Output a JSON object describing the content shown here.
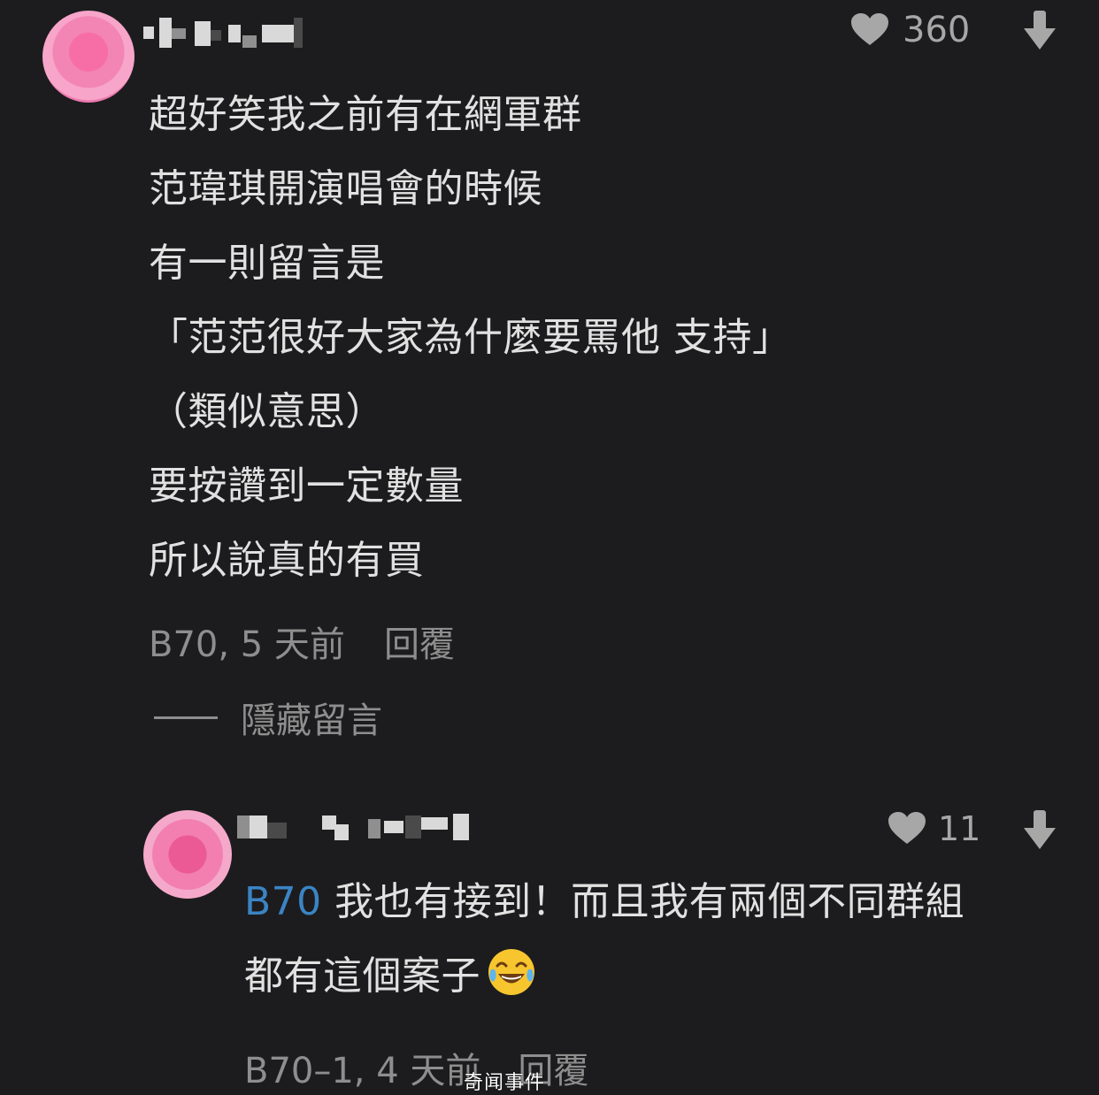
{
  "comment": {
    "likes": "360",
    "lines": [
      "超好笑我之前有在網軍群",
      "范瑋琪開演唱會的時候",
      "有一則留言是",
      "「范范很好大家為什麼要罵他 支持」",
      "（類似意思）",
      "要按讚到一定數量",
      "所以說真的有買"
    ],
    "meta": "B70, 5 天前",
    "reply_label": "回覆",
    "hide_label": "隱藏留言"
  },
  "reply": {
    "likes": "11",
    "mention": "B70",
    "line1": " 我也有接到！而且我有兩個不同群組",
    "line2": "都有這個案子",
    "meta": "B70–1, 4 天前",
    "reply_label": "回覆"
  },
  "watermark": "奇闻事件",
  "colors": {
    "background": "#1c1c1e",
    "text": "#e1e1e1",
    "muted": "#8e8e8e",
    "mention": "#3b84c4",
    "avatar": "#e87aae"
  },
  "icons": {
    "like": "heart-icon",
    "dislike": "arrow-down-icon",
    "emoji": "tears-of-joy-emoji"
  }
}
